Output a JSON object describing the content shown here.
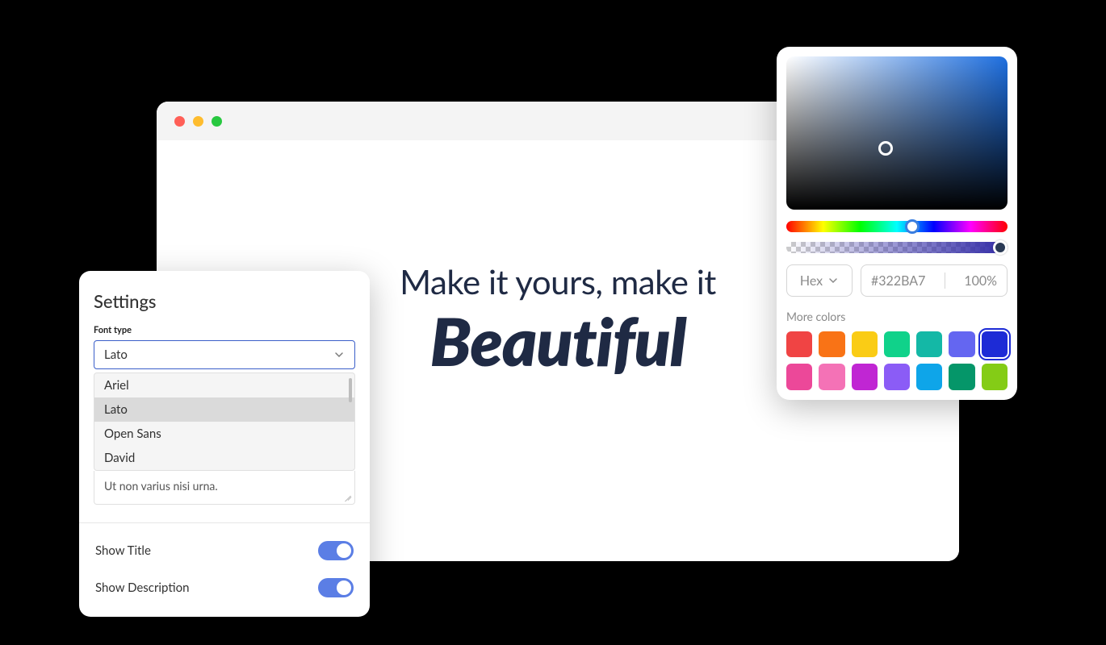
{
  "canvas": {
    "line1": "Make it yours, make it",
    "line2": "Beautiful"
  },
  "settings": {
    "title": "Settings",
    "font_type_label": "Font type",
    "selected_font": "Lato",
    "font_options": [
      "Ariel",
      "Lato",
      "Open Sans",
      "David"
    ],
    "textarea_value": "Ut non varius nisi urna.",
    "toggles": [
      {
        "label": "Show Title",
        "on": true
      },
      {
        "label": "Show Description",
        "on": true
      }
    ]
  },
  "picker": {
    "format_label": "Hex",
    "hex_value": "#322BA7",
    "opacity_value": "100%",
    "more_label": "More colors",
    "swatches_row1": [
      "#f04444",
      "#f97316",
      "#facc15",
      "#10d28a",
      "#14b8a6",
      "#6466f1",
      "#1d2bd6"
    ],
    "swatches_row2": [
      "#ec4899",
      "#f472b6",
      "#c026d3",
      "#8b5cf6",
      "#0ea5e9",
      "#059669",
      "#84cc16"
    ],
    "selected_swatch_index": 6
  }
}
